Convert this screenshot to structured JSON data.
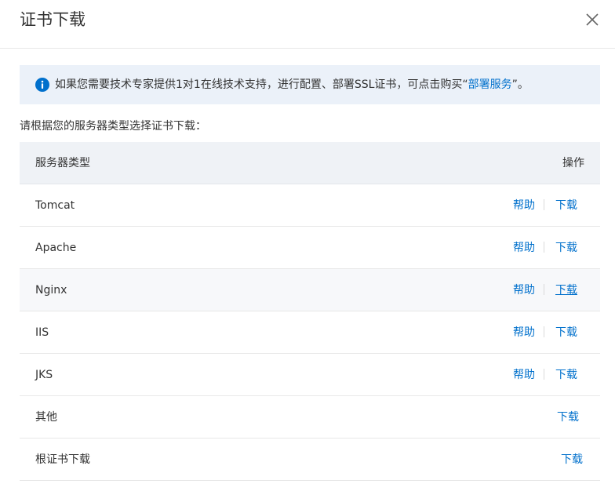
{
  "dialog": {
    "title": "证书下载",
    "close_icon": "close-icon"
  },
  "notice": {
    "icon": "info-icon",
    "text_prefix": "如果您需要技术专家提供1对1在线技术支持，进行配置、部署SSL证书，可点击购买“",
    "link_label": "部署服务",
    "text_suffix": "”。"
  },
  "instruction": "请根据您的服务器类型选择证书下载：",
  "table": {
    "headers": {
      "type": "服务器类型",
      "operation": "操作"
    },
    "rows": [
      {
        "name": "Tomcat",
        "help": "帮助",
        "download": "下载"
      },
      {
        "name": "Apache",
        "help": "帮助",
        "download": "下载"
      },
      {
        "name": "Nginx",
        "help": "帮助",
        "download": "下载"
      },
      {
        "name": "IIS",
        "help": "帮助",
        "download": "下载"
      },
      {
        "name": "JKS",
        "help": "帮助",
        "download": "下载"
      },
      {
        "name": "其他",
        "download": "下载"
      },
      {
        "name": "根证书下载",
        "download": "下载"
      }
    ]
  },
  "colors": {
    "accent": "#0070cc",
    "notice_bg": "#ebf1f9",
    "header_bg": "#eff2f6"
  }
}
